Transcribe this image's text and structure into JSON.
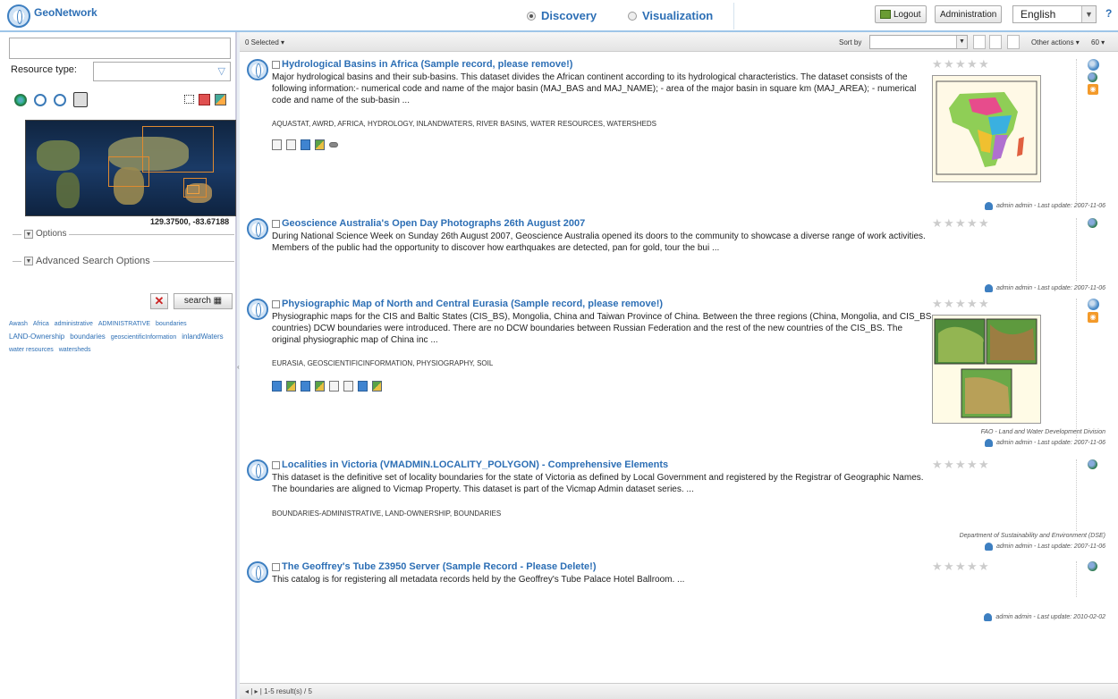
{
  "app": {
    "title": "GeoNetwork"
  },
  "header": {
    "modes": [
      "Discovery",
      "Visualization"
    ],
    "logout": "Logout",
    "admin": "Administration",
    "language": "English",
    "help": "?"
  },
  "sidebar": {
    "search_value": "",
    "resource_type_label": "Resource type:",
    "resource_type_value": "",
    "coords": "129.37500, -83.67188",
    "options_label": "Options",
    "advanced_label": "Advanced Search Options",
    "clear_label": "✕",
    "search_label": "search",
    "tags": [
      "Awash",
      "Africa",
      "administrative",
      "ADMINISTRATIVE",
      "boundaries",
      "LAND-Ownership",
      "boundaries",
      "geoscientificInformation",
      "inlandWaters",
      "water resources",
      "watersheds"
    ]
  },
  "toolbar": {
    "selected": "0 Selected ▾",
    "sort_by": "Sort by",
    "sort_value": "",
    "other_actions": "Other actions ▾",
    "per_page": "60 ▾"
  },
  "records": [
    {
      "title": "Hydrological Basins in Africa (Sample record, please remove!)",
      "abstract": "Major hydrological basins and their sub-basins. This dataset divides the African continent according to its hydrological characteristics. The dataset consists of the following information:- numerical code and name of the major basin (MAJ_BAS and MAJ_NAME); - area of the major basin in square km (MAJ_AREA); - numerical code and name of the sub-basin ...",
      "keywords": "AQUASTAT, AWRD, AFRICA, HYDROLOGY, INLANDWATERS, RIVER BASINS, WATER RESOURCES, WATERSHEDS",
      "org": "",
      "meta": "admin admin - Last update: 2007-11-06"
    },
    {
      "title": "Geoscience Australia's Open Day Photographs 26th August 2007",
      "abstract": "During National Science Week on Sunday 26th August 2007, Geoscience Australia opened its doors to the community to showcase a diverse range of work activities. Members of the public had the opportunity to discover how earthquakes are detected, pan for gold, tour the bui ...",
      "keywords": "",
      "org": "",
      "meta": "admin admin - Last update: 2007-11-06"
    },
    {
      "title": "Physiographic Map of North and Central Eurasia (Sample record, please remove!)",
      "abstract": "Physiographic maps for the CIS and Baltic States (CIS_BS), Mongolia, China and Taiwan Province of China. Between the three regions (China, Mongolia, and CIS_BS countries) DCW boundaries were introduced. There are no DCW boundaries between Russian Federation and the rest of the new countries of the CIS_BS. The original physiographic map of China inc ...",
      "keywords": "EURASIA, GEOSCIENTIFICINFORMATION, PHYSIOGRAPHY, SOIL",
      "org": "FAO - Land and Water Development Division",
      "meta": "admin admin - Last update: 2007-11-06"
    },
    {
      "title": "Localities in Victoria (VMADMIN.LOCALITY_POLYGON) - Comprehensive Elements",
      "abstract": "This dataset is the definitive set of locality boundaries for the state of Victoria as defined by Local Government and registered by the Registrar of Geographic Names. The boundaries are aligned to Vicmap Property. This dataset is part of the Vicmap Admin dataset series. ...",
      "keywords": "BOUNDARIES-ADMINISTRATIVE, LAND-OWNERSHIP, BOUNDARIES",
      "org": "Department of Sustainability and Environment (DSE)",
      "meta": "admin admin - Last update: 2007-11-06"
    },
    {
      "title": "The Geoffrey's Tube Z3950 Server (Sample Record - Please Delete!)",
      "abstract": "This catalog is for registering all metadata records held by the Geoffrey's Tube Palace Hotel Ballroom. ...",
      "keywords": "",
      "org": "",
      "meta": "admin admin - Last update: 2010-02-02"
    }
  ],
  "footer": {
    "pagination": "1-5 result(s) / 5"
  },
  "colors": {
    "accent": "#2d6fb5",
    "header_border": "#9ec5e8"
  }
}
